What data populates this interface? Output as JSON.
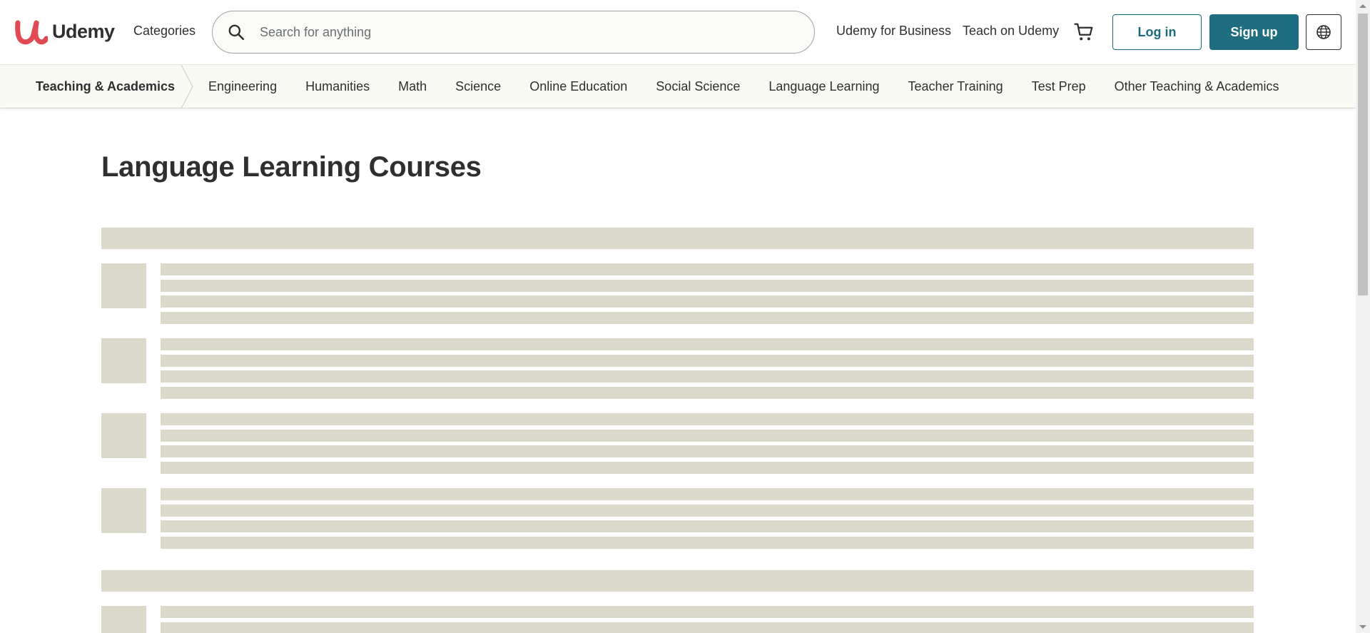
{
  "brand": {
    "name": "Udemy"
  },
  "header": {
    "categories_label": "Categories",
    "search_placeholder": "Search for anything",
    "business_link": "Udemy for Business",
    "teach_link": "Teach on Udemy",
    "login_label": "Log in",
    "signup_label": "Sign up"
  },
  "subnav": {
    "current": "Teaching & Academics",
    "items": [
      "Engineering",
      "Humanities",
      "Math",
      "Science",
      "Online Education",
      "Social Science",
      "Language Learning",
      "Teacher Training",
      "Test Prep",
      "Other Teaching & Academics"
    ]
  },
  "main": {
    "title": "Language Learning Courses"
  },
  "colors": {
    "brand_purple": "#1c6a7e",
    "logo_red": "#e04a52",
    "skeleton": "#dbd9ca",
    "subnav_bg": "#fafaf5"
  },
  "icons": [
    "search-icon",
    "cart-icon",
    "globe-icon",
    "chevron-right-icon"
  ]
}
